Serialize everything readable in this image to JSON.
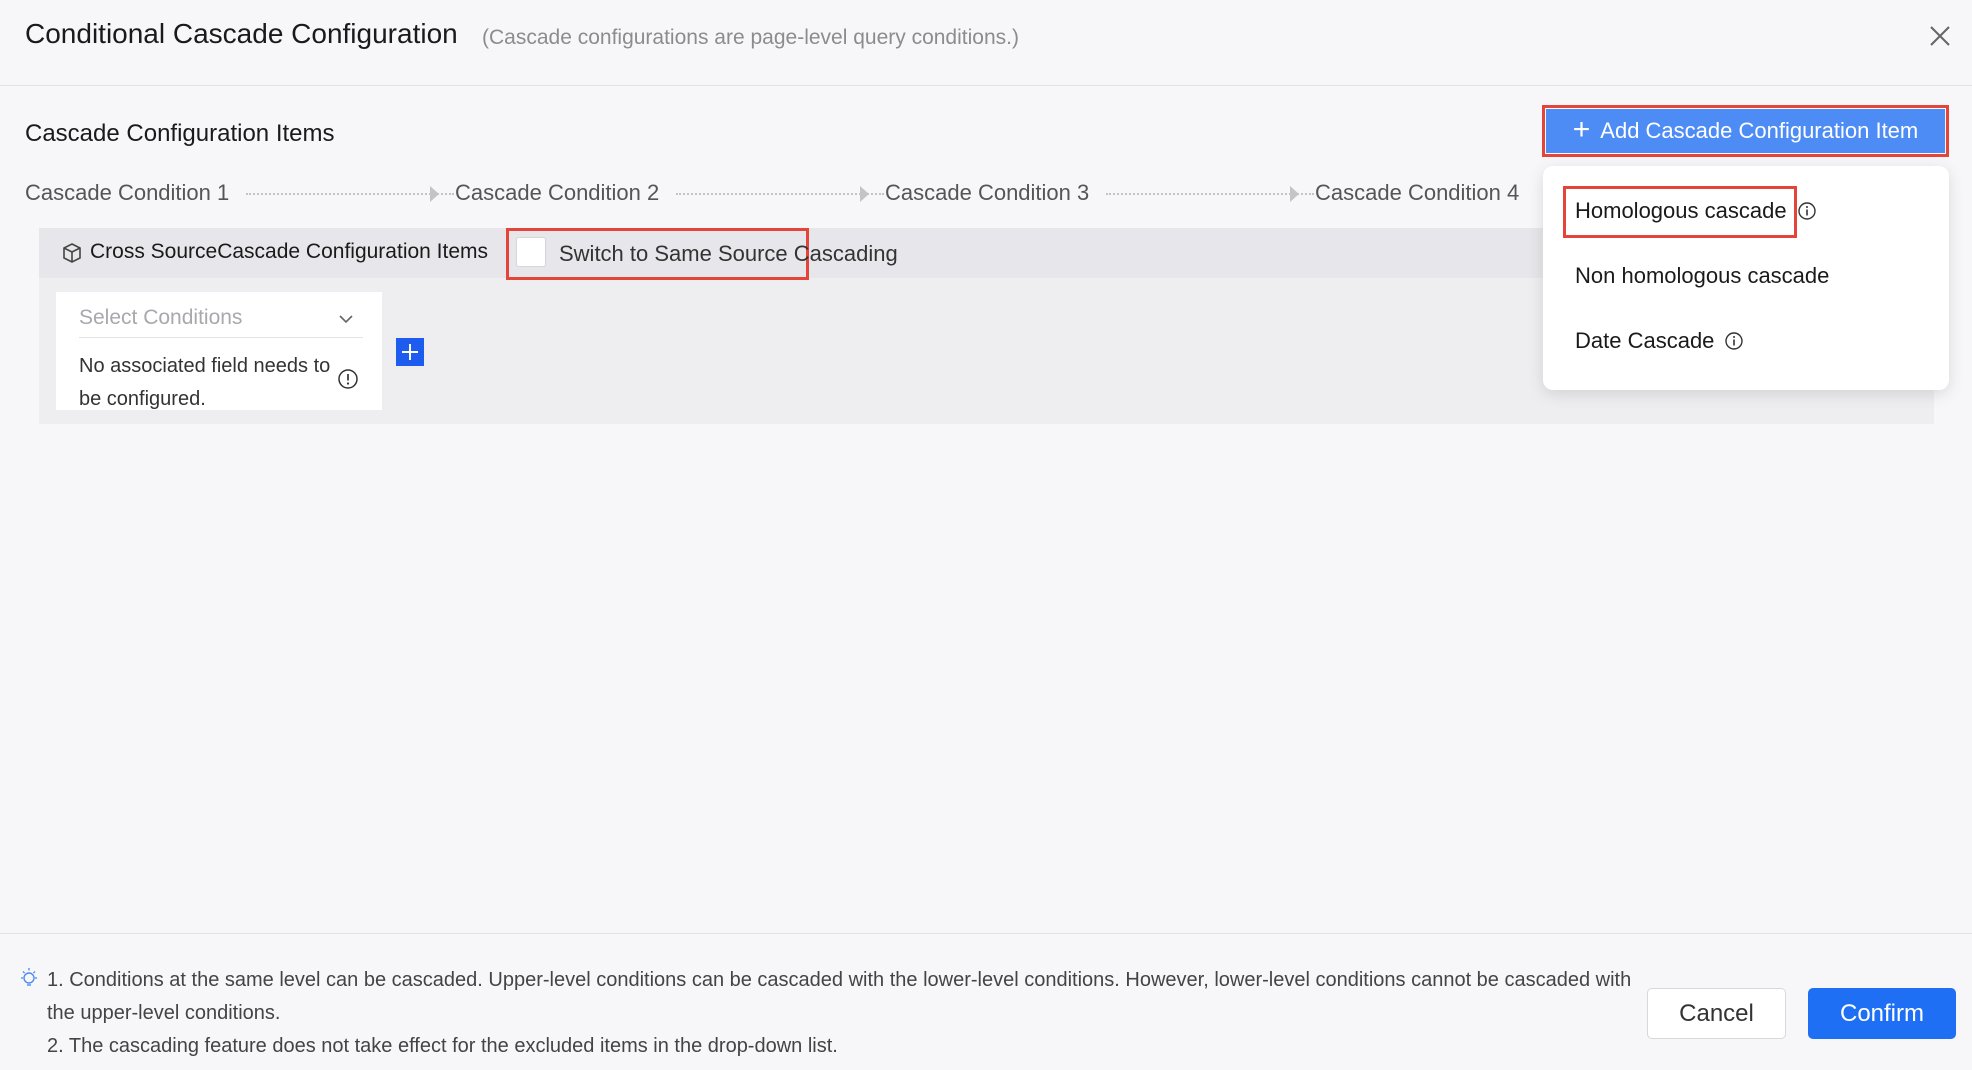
{
  "dialog": {
    "title": "Conditional Cascade Configuration",
    "subtitle": "(Cascade configurations are page-level query conditions.)"
  },
  "section": {
    "title": "Cascade Configuration Items",
    "add_button_label": "Add Cascade Configuration Item"
  },
  "steps": [
    "Cascade Condition 1",
    "Cascade Condition 2",
    "Cascade Condition 3",
    "Cascade Condition 4"
  ],
  "panel": {
    "label": "Cross SourceCascade Configuration Items",
    "switch_label": "Switch to Same Source Cascading",
    "switch_checked": false,
    "select_placeholder": "Select Conditions",
    "note": "No associated field needs to be configured."
  },
  "dropdown": {
    "items": [
      {
        "label": "Homologous cascade",
        "has_info": true
      },
      {
        "label": "Non homologous cascade",
        "has_info": false
      },
      {
        "label": "Date Cascade",
        "has_info": true
      }
    ]
  },
  "footer": {
    "tip1": "1. Conditions at the same level can be cascaded. Upper-level conditions can be cascaded with the lower-level conditions. However, lower-level conditions cannot be cascaded with the upper-level conditions.",
    "tip2": "2. The cascading feature does not take effect for the excluded items in the drop-down list.",
    "cancel_label": "Cancel",
    "confirm_label": "Confirm"
  },
  "colors": {
    "primary": "#1f6ff5",
    "add_button": "#4d8bf5",
    "highlight": "#e4453a"
  }
}
